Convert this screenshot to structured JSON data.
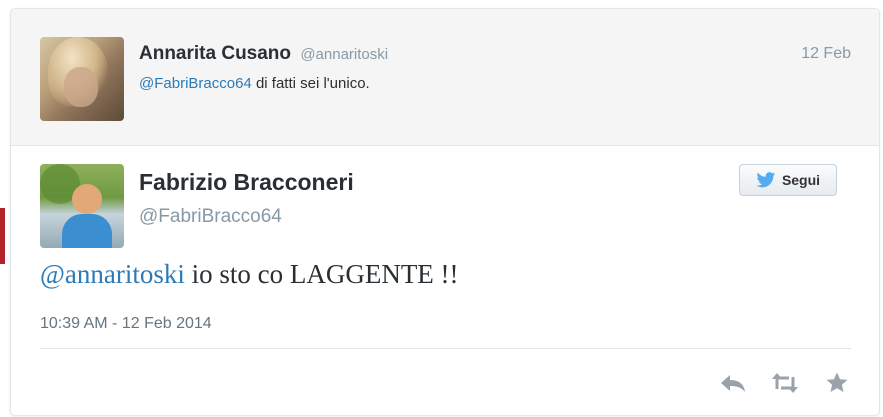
{
  "reply_context": {
    "author_name": "Annarita Cusano",
    "author_handle": "@annaritoski",
    "date": "12 Feb",
    "mention": "@FabriBracco64",
    "text": " di fatti sei l'unico."
  },
  "tweet": {
    "author_name": "Fabrizio Bracconeri",
    "author_handle": "@FabriBracco64",
    "follow_label": "Segui",
    "mention": "@annaritoski",
    "text": " io sto co LAGGENTE !!",
    "timestamp": "10:39 AM - 12 Feb 2014"
  },
  "icons": {
    "follow": "twitter-bird-icon",
    "reply": "reply-icon",
    "retweet": "retweet-icon",
    "favorite": "star-icon"
  },
  "colors": {
    "link": "#2b7bb9",
    "twitter_blue": "#55acee",
    "icon_gray": "#9aa3ab"
  }
}
